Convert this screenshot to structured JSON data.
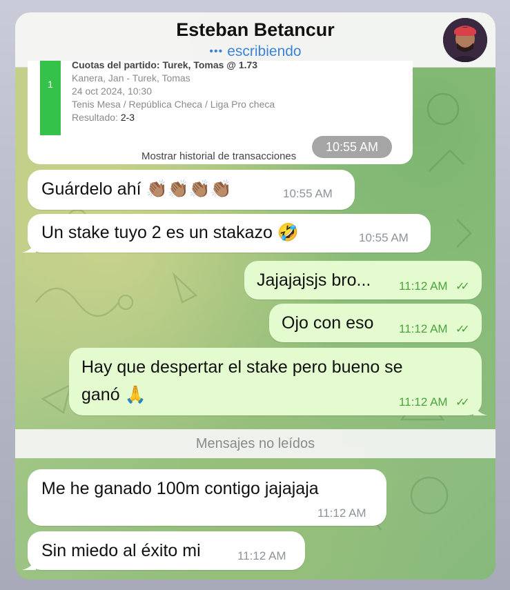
{
  "header": {
    "contact_name": "Esteban Betancur",
    "typing_indicator": "•••",
    "status": "escribiendo"
  },
  "bet_card": {
    "header_line": "Cuotas del partido: Turek, Tomas @ 1.73",
    "index": "1",
    "match": "Kanera, Jan - Turek, Tomas",
    "datetime": "24 oct 2024, 10:30",
    "league": "Tenis Mesa / República Checa / Liga Pro checa",
    "result_label": "Resultado:",
    "result_value": "2-3",
    "history_link": "Mostrar historial de transacciones",
    "time": "10:55 AM"
  },
  "messages": [
    {
      "id": "m1",
      "direction": "in",
      "text": "Guárdelo ahí 👏🏽👏🏽👏🏽👏🏽",
      "time": "10:55 AM"
    },
    {
      "id": "m2",
      "direction": "in",
      "text": "Un stake tuyo 2 es un stakazo 🤣",
      "time": "10:55 AM"
    },
    {
      "id": "m3",
      "direction": "out",
      "text": "Jajajajsjs bro...",
      "time": "11:12 AM"
    },
    {
      "id": "m4",
      "direction": "out",
      "text": "Ojo con eso",
      "time": "11:12 AM"
    },
    {
      "id": "m5",
      "direction": "out",
      "text_line1": "Hay que despertar el stake pero bueno se",
      "text_line2": "ganó 🙏",
      "time": "11:12 AM"
    },
    {
      "id": "m6",
      "direction": "in",
      "text": "Me he ganado 100m contigo jajajaja",
      "time": "11:12 AM"
    },
    {
      "id": "m7",
      "direction": "in",
      "text": "Sin miedo al éxito mi",
      "time": "11:12 AM"
    }
  ],
  "unread_divider": "Mensajes no leídos",
  "read_checks": "✓✓",
  "colors": {
    "incoming_bubble": "#ffffff",
    "outgoing_bubble": "#e3fbcf",
    "outgoing_time": "#4aa33d",
    "accent_blue": "#3a83d8",
    "bet_bar": "#35c24a"
  }
}
